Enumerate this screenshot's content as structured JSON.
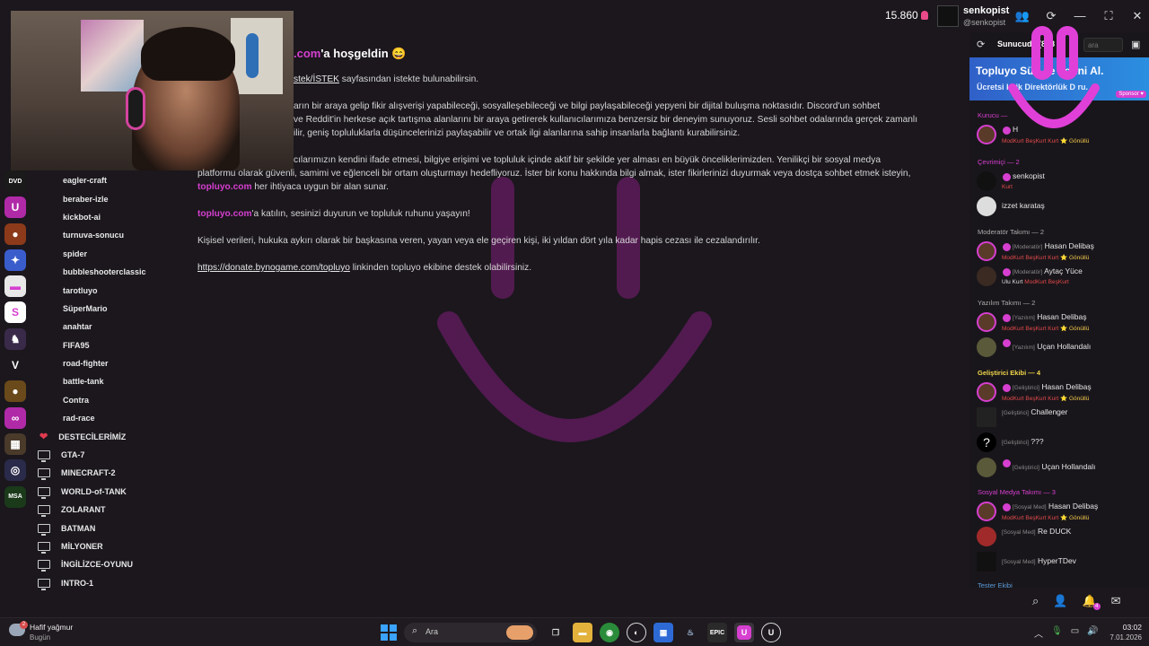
{
  "header": {
    "coins": "15.860",
    "username": "senkopist",
    "handle": "@senkopist",
    "icons": [
      "people-icon",
      "refresh-icon",
      "minimize-icon",
      "maximize-icon",
      "close-icon"
    ]
  },
  "rail_icons": [
    {
      "name": "dvd-icon",
      "bg": "#1a1a1a",
      "glyph": "DVD"
    },
    {
      "name": "topluyo-icon",
      "bg": "#b02aa8",
      "glyph": "U"
    },
    {
      "name": "game-icon-1",
      "bg": "#8c3a1a",
      "glyph": "●"
    },
    {
      "name": "game-icon-2",
      "bg": "#3a5dcc",
      "glyph": "✦"
    },
    {
      "name": "game-icon-3",
      "bg": "#e8e8e8",
      "glyph": "▬"
    },
    {
      "name": "game-icon-4",
      "bg": "#fff",
      "glyph": "S"
    },
    {
      "name": "game-icon-5",
      "bg": "#3a2a4a",
      "glyph": "♞"
    },
    {
      "name": "valorant-icon",
      "bg": "#1b171d",
      "glyph": "V"
    },
    {
      "name": "game-icon-6",
      "bg": "#6a4a1a",
      "glyph": "●"
    },
    {
      "name": "game-icon-7",
      "bg": "#b02aa8",
      "glyph": "∞"
    },
    {
      "name": "game-icon-8",
      "bg": "#4a3a2a",
      "glyph": "▦"
    },
    {
      "name": "game-icon-9",
      "bg": "#2a2a4a",
      "glyph": "◎"
    },
    {
      "name": "game-icon-10",
      "bg": "#1a3a1a",
      "glyph": "MSA"
    }
  ],
  "channels": [
    {
      "label": "eagler-craft",
      "type": "plain"
    },
    {
      "label": "beraber-izle",
      "type": "plain"
    },
    {
      "label": "kickbot-ai",
      "type": "plain"
    },
    {
      "label": "turnuva-sonucu",
      "type": "plain"
    },
    {
      "label": "spider",
      "type": "plain"
    },
    {
      "label": "bubbleshooterclassic",
      "type": "plain"
    },
    {
      "label": "tarotluyo",
      "type": "plain"
    },
    {
      "label": "SüperMario",
      "type": "plain"
    },
    {
      "label": "anahtar",
      "type": "plain"
    },
    {
      "label": "FIFA95",
      "type": "plain"
    },
    {
      "label": "road-fighter",
      "type": "plain"
    },
    {
      "label": "battle-tank",
      "type": "plain"
    },
    {
      "label": "Contra",
      "type": "plain"
    },
    {
      "label": "rad-race",
      "type": "plain"
    },
    {
      "label": "DESTECİLERİMİZ",
      "type": "heart"
    },
    {
      "label": "GTA-7",
      "type": "monitor"
    },
    {
      "label": "MINECRAFT-2",
      "type": "monitor"
    },
    {
      "label": "WORLD-of-TANK",
      "type": "monitor"
    },
    {
      "label": "ZOLARANT",
      "type": "monitor"
    },
    {
      "label": "BATMAN",
      "type": "monitor"
    },
    {
      "label": "MİLYONER",
      "type": "monitor"
    },
    {
      "label": "İNGİLİZCE-OYUNU",
      "type": "monitor"
    },
    {
      "label": "INTRO-1",
      "type": "monitor-outline"
    }
  ],
  "main": {
    "welcome_brand": ".com",
    "welcome_rest": "'a hoşgeldin 😄",
    "p1_link": "stek/İSTEK",
    "p1_rest": " sayfasından istekte bulunabilirsin.",
    "p2_l1": "arın bir araya gelip fikir alışverişi yapabileceği, sosyalleşebileceği ve bilgi paylaşabileceği yepyeni bir dijital buluşma noktasıdır. Discord'un sohbet",
    "p2_l2": "ve Reddit'in herkese açık tartışma alanlarını bir araya getirerek kullanıcılarımıza benzersiz bir deneyim sunuyoruz. Sesli sohbet odalarında gerçek zamanlı",
    "p2_l3": "ilir, geniş topluluklarla düşüncelerinizi paylaşabilir ve ortak ilgi alanlarına sahip insanlarla bağlantı kurabilirsiniz.",
    "p3_l1": "cılarımızın kendini ifade etmesi, bilgiye erişimi ve topluluk içinde aktif bir şekilde yer alması en büyük önceliklerimizden. Yenilikçi bir sosyal medya",
    "p3_l2": "platformu olarak güvenli, samimi ve eğlenceli bir ortam oluşturmayı hedefliyoruz. İster bir konu hakkında bilgi almak, ister fikirlerinizi duyurmak veya dostça sohbet etmek isteyin,",
    "p3_brand": "topluyo.com",
    "p3_l3": " her ihtiyaca uygun bir alan sunar.",
    "p4_brand": "topluyo.com",
    "p4_rest": "'a katılın, sesinizi duyurun ve topluluk ruhunu yaşayın!",
    "p5": " Kişisel verileri, hukuka aykırı olarak bir başkasına veren, yayan veya ele geçiren kişi, iki yıldan dört yıla kadar hapis cezası ile cezalandırılır.",
    "p6_link": "https://donate.bynogame.com/topluyo",
    "p6_rest": " linkinden topluyo ekibine destek olabilirsiniz."
  },
  "right": {
    "title": "Sunucuda (858",
    "search_placeholder": "ara",
    "banner_t1": "Topluyo Sü    Li   e Yerini Al.",
    "banner_t2": "Ücretsi    knik Direktörlük D    ru.",
    "banner_sponsor": "Sponsor ♥",
    "sections": {
      "s1": "Kurucu —",
      "s2": "Çevrimiçi — 2",
      "s3": "Moderatör Takımı — 2",
      "s4": "Yazılım Takımı — 2",
      "s5": "Geliştirici Ekibi — 4",
      "s6": "Sosyal Medya Takımı — 3",
      "s7": "Tester Ekibi"
    },
    "members": {
      "m1_name": "H",
      "m1_role": "ModKurt BeşKurt Kurt",
      "m1_gon": "⭐ Gönüllü",
      "m2_name": "senkopist",
      "m2_role": "Kurt",
      "m3_name": "izzet karataş",
      "m4_tag": "[Moderatör]",
      "m4_name": "Hasan Delibaş",
      "m4_role": "ModKurt BeşKurt Kurt",
      "m4_gon": "⭐ Gönüllü",
      "m5_tag": "[Moderatör]",
      "m5_name": "Aytaç Yüce",
      "m5_sub": "Ulu Kurt",
      "m5_role": "ModKurt BeşKurt",
      "m6_tag": "[Yazılım]",
      "m6_name": "Hasan Delibaş",
      "m6_role": "ModKurt BeşKurt Kurt",
      "m6_gon": "⭐ Gönüllü",
      "m7_tag": "[Yazılım]",
      "m7_name": "Uçan Hollandalı",
      "m8_tag": "[Geliştirici]",
      "m8_name": "Hasan Delibaş",
      "m8_role": "ModKurt BeşKurt Kurt",
      "m8_gon": "⭐ Gönüllü",
      "m9_tag": "[Geliştirici]",
      "m9_name": "Challenger",
      "m10_tag": "[Geliştirici]",
      "m10_name": "???",
      "m11_tag": "[Geliştirici]",
      "m11_name": "Uçan Hollandalı",
      "m12_tag": "[Sosyal Med]",
      "m12_name": "Hasan Delibaş",
      "m12_role": "ModKurt BeşKurt Kurt",
      "m12_gon": "⭐ Gönüllü",
      "m13_tag": "[Sosyal Med]",
      "m13_name": "Re DUCK",
      "m14_tag": "[Sosyal Med]",
      "m14_name": "HyperTDev"
    },
    "notif_count": "4"
  },
  "taskbar": {
    "weather": "Hafif yağmur",
    "weather_sub": "Bugün",
    "weather_badge": "2",
    "search_label": "Ara",
    "time": "03:02",
    "date": "7.01.2026"
  },
  "colors": {
    "accent": "#d63fd0",
    "background": "#1b171d"
  }
}
